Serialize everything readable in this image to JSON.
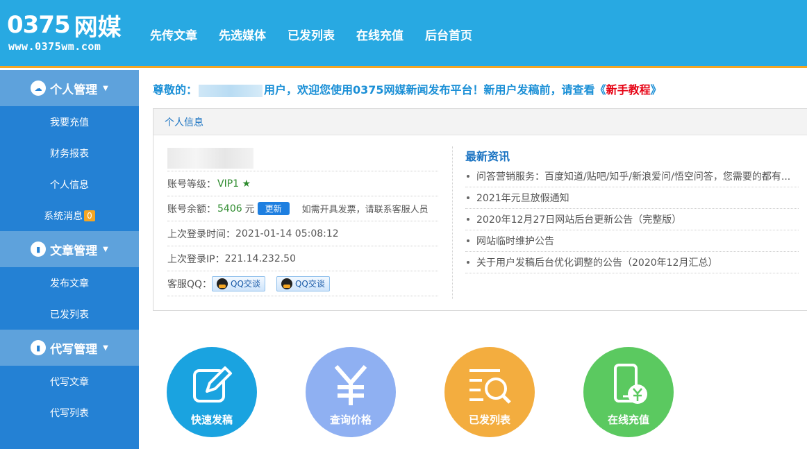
{
  "logo": {
    "digits": "0375",
    "brand": "网媒",
    "url": "www.0375wm.com"
  },
  "nav": [
    "先传文章",
    "先选媒体",
    "已发列表",
    "在线充值",
    "后台首页"
  ],
  "sidebar": {
    "groups": [
      {
        "label": "个人管理",
        "items": [
          "我要充值",
          "财务报表",
          "个人信息",
          "系统消息"
        ]
      },
      {
        "label": "文章管理",
        "items": [
          "发布文章",
          "已发列表"
        ]
      },
      {
        "label": "代写管理",
        "items": [
          "代写文章",
          "代写列表"
        ]
      }
    ],
    "message_count": "0"
  },
  "welcome": {
    "prefix": "尊敬的：",
    "middle": "用户，欢迎您使用0375网媒新闻发布平台！新用户发稿前，请查看《",
    "link": "新手教程",
    "suffix": "》"
  },
  "panel": {
    "title": "个人信息",
    "level_label": "账号等级：",
    "level_value": "VIP1 ★",
    "balance_label": "账号余额：",
    "balance_value": "5406",
    "balance_unit": "元",
    "renew_button": "更新",
    "invoice_note": "如需开具发票，请联系客服人员",
    "last_login_time_label": "上次登录时间：",
    "last_login_time": "2021-01-14 05:08:12",
    "last_login_ip_label": "上次登录IP：",
    "last_login_ip": "221.14.232.50",
    "service_label": "客服QQ：",
    "qq_button": "QQ交谈"
  },
  "news": {
    "title": "最新资讯",
    "items": [
      "问答营销服务：百度知道/贴吧/知乎/新浪爱问/悟空问答，您需要的都有...",
      "2021年元旦放假通知",
      "2020年12月27日网站后台更新公告（完整版）",
      "网站临时维护公告",
      "关于用户发稿后台优化调整的公告（2020年12月汇总）"
    ]
  },
  "quick_actions": [
    {
      "label": "快速发稿",
      "color": "#1aa3e0",
      "icon": "edit-icon"
    },
    {
      "label": "查询价格",
      "color": "#8fb0f2",
      "icon": "yen-icon"
    },
    {
      "label": "已发列表",
      "color": "#f3ad3f",
      "icon": "list-search-icon"
    },
    {
      "label": "在线充值",
      "color": "#5bc960",
      "icon": "phone-yen-icon"
    }
  ],
  "colors": {
    "header": "#28a9e2",
    "header_border": "#f5a623",
    "sidebar": "#2481d4",
    "sidebar_group": "#5ea2dc",
    "accent_red": "#e60012"
  }
}
